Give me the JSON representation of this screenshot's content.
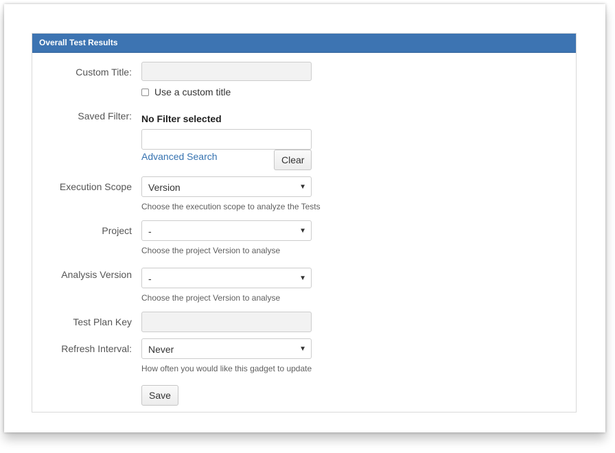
{
  "panel": {
    "title": "Overall Test Results"
  },
  "form": {
    "custom_title": {
      "label": "Custom Title:",
      "value": "",
      "checkbox_label": "Use a custom title",
      "checked": false
    },
    "saved_filter": {
      "label": "Saved Filter:",
      "selected_text": "No Filter selected",
      "value": "",
      "advanced_search_label": "Advanced Search",
      "clear_label": "Clear"
    },
    "execution_scope": {
      "label": "Execution Scope",
      "value": "Version",
      "help": "Choose the execution scope to analyze the Tests"
    },
    "project": {
      "label": "Project",
      "value": "-",
      "help": "Choose the project Version to analyse"
    },
    "analysis_version": {
      "label": "Analysis Version",
      "value": "-",
      "help": "Choose the project Version to analyse"
    },
    "test_plan_key": {
      "label": "Test Plan Key",
      "value": ""
    },
    "refresh_interval": {
      "label": "Refresh Interval:",
      "value": "Never",
      "help": "How often you would like this gadget to update"
    },
    "save_label": "Save"
  },
  "icons": {
    "dropdown": "chevron-down-icon"
  },
  "colors": {
    "header_blue": "#3d74b2",
    "link_blue": "#3572b0"
  }
}
